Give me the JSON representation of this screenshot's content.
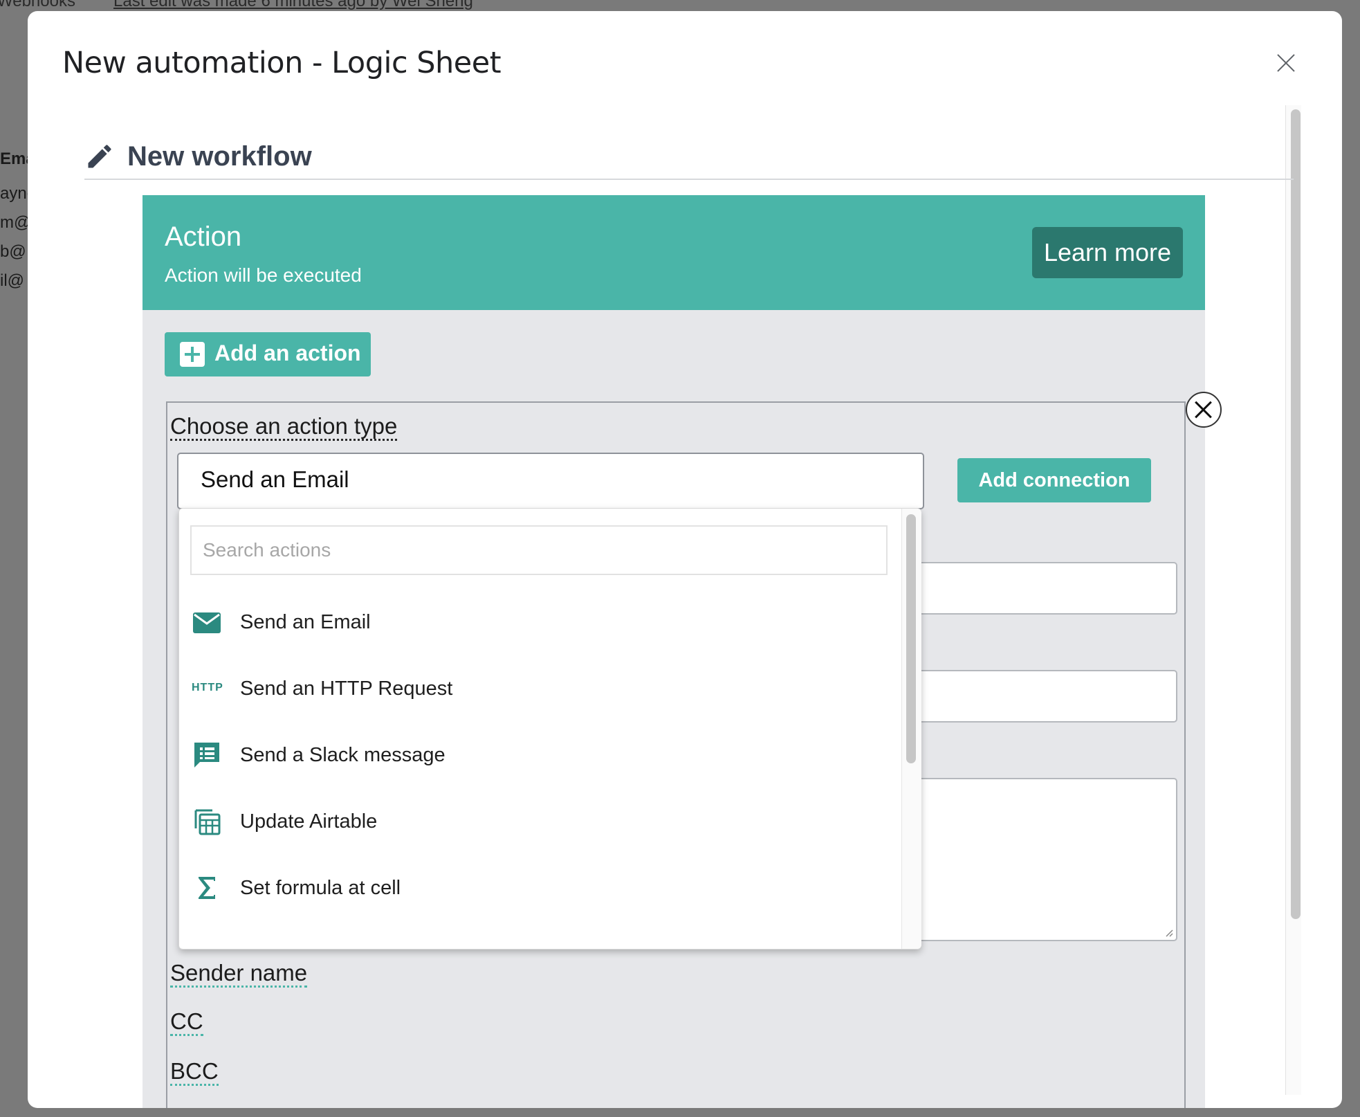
{
  "background": {
    "top_left_text": "Webhooks",
    "last_edit": "Last edit was made 6 minutes ago by Wei Sheng",
    "column_header": "Email",
    "cells": [
      "ayne",
      "m@",
      "b@",
      "il@"
    ]
  },
  "modal": {
    "title": "New automation - Logic Sheet",
    "workflow_title": "New workflow"
  },
  "action_card": {
    "title": "Action",
    "subtitle": "Action will be executed",
    "learn_more": "Learn more",
    "add_action": "Add an action",
    "choose_type_label": "Choose an action type",
    "selected_type": "Send an Email",
    "add_connection": "Add connection",
    "sender_name_label": "Sender name",
    "cc_label": "CC",
    "bcc_label": "BCC"
  },
  "dropdown": {
    "search_placeholder": "Search actions",
    "items": [
      {
        "label": "Send an Email",
        "icon": "mail-icon"
      },
      {
        "label": "Send an HTTP Request",
        "icon": "http-icon",
        "icon_text": "HTTP"
      },
      {
        "label": "Send a Slack message",
        "icon": "chat-list-icon"
      },
      {
        "label": "Update Airtable",
        "icon": "table-icon"
      },
      {
        "label": "Set formula at cell",
        "icon": "sigma-icon"
      }
    ]
  },
  "colors": {
    "accent": "#4ab5a8",
    "accent_dark": "#2b786e",
    "card_bg": "#e6e7ea"
  }
}
